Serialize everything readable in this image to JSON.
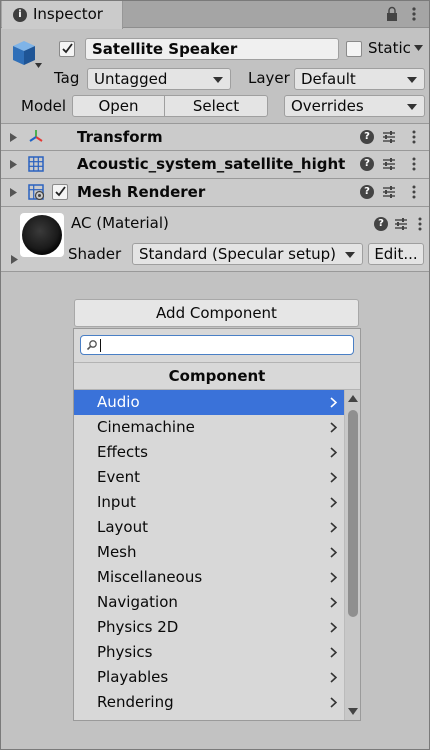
{
  "tab": {
    "label": "Inspector",
    "icon": "info-icon"
  },
  "object": {
    "name": "Satellite Speaker",
    "active": true,
    "static_label": "Static",
    "tag_label": "Tag",
    "tag_value": "Untagged",
    "layer_label": "Layer",
    "layer_value": "Default",
    "model_label": "Model",
    "open_label": "Open",
    "select_label": "Select",
    "overrides_label": "Overrides"
  },
  "components": [
    {
      "title": "Transform",
      "icon": "transform-icon"
    },
    {
      "title": "Acoustic_system_satellite_hight",
      "icon": "mesh-filter-icon"
    },
    {
      "title": "Mesh Renderer",
      "icon": "mesh-renderer-icon",
      "enabled": true
    }
  ],
  "material": {
    "title": "AC (Material)",
    "shader_label": "Shader",
    "shader_value": "Standard (Specular setup)",
    "edit_label": "Edit..."
  },
  "add_component": {
    "button_label": "Add Component",
    "search_value": "",
    "header": "Component",
    "items": [
      "Audio",
      "Cinemachine",
      "Effects",
      "Event",
      "Input",
      "Layout",
      "Mesh",
      "Miscellaneous",
      "Navigation",
      "Physics 2D",
      "Physics",
      "Playables",
      "Rendering"
    ],
    "selected_index": 0
  },
  "colors": {
    "selection": "#3a72d9",
    "panel": "#c2c2c2",
    "header": "#cbcbcb"
  }
}
